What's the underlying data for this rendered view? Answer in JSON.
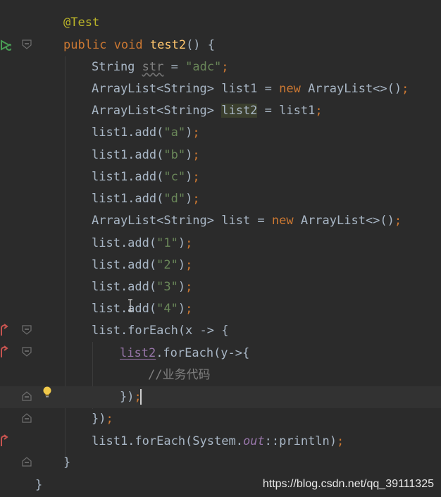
{
  "editor": {
    "language": "java",
    "theme_colors": {
      "background": "#2b2b2b",
      "current_line": "#323232",
      "keyword": "#cc7832",
      "annotation": "#bbb529",
      "string": "#6a8759",
      "method_declaration": "#ffc66d",
      "comment": "#808080",
      "static_field": "#9876aa",
      "default_text": "#a9b7c6"
    },
    "gutter_icons": [
      "run-test-icon",
      "fold-icon",
      "recursive-call-icon",
      "intention-bulb-icon"
    ],
    "current_line_number": 18,
    "code": {
      "l1_annotation": "@Test",
      "l2_public": "public",
      "l2_void": "void",
      "l2_name": "test2",
      "l2_rest": "() {",
      "l3_type": "String",
      "l3_var": "str",
      "l3_eq": " = ",
      "l3_value": "\"adc\"",
      "l3_semi": ";",
      "l4_decl": "ArrayList<String> list1 = ",
      "l4_new": "new",
      "l4_ctor": " ArrayList<>()",
      "l4_semi": ";",
      "l5_decl": "ArrayList<String> ",
      "l5_var": "list2",
      "l5_assign": " = list1",
      "l5_semi": ";",
      "l6_call": "list1.add(",
      "l6_arg": "\"a\"",
      "l6_end": ")",
      "l6_semi": ";",
      "l7_call": "list1.add(",
      "l7_arg": "\"b\"",
      "l7_end": ")",
      "l7_semi": ";",
      "l8_call": "list1.add(",
      "l8_arg": "\"c\"",
      "l8_end": ")",
      "l8_semi": ";",
      "l9_call": "list1.add(",
      "l9_arg": "\"d\"",
      "l9_end": ")",
      "l9_semi": ";",
      "l10_decl": "ArrayList<String> list = ",
      "l10_new": "new",
      "l10_ctor": " ArrayList<>()",
      "l10_semi": ";",
      "l11_call": "list.add(",
      "l11_arg": "\"1\"",
      "l11_end": ")",
      "l11_semi": ";",
      "l12_call": "list.add(",
      "l12_arg": "\"2\"",
      "l12_end": ")",
      "l12_semi": ";",
      "l13_call": "list.add(",
      "l13_arg": "\"3\"",
      "l13_end": ")",
      "l13_semi": ";",
      "l14_call": "list.add(",
      "l14_arg": "\"4\"",
      "l14_end": ")",
      "l14_semi": ";",
      "l15_text": "list.forEach(x -> {",
      "l16_var": "list2",
      "l16_rest": ".forEach(y->{",
      "l17_comment": "//业务代码",
      "l18_text": "})",
      "l18_semi": ";",
      "l19_text": "})",
      "l19_semi": ";",
      "l20_call": "list1.forEach(System.",
      "l20_field": "out",
      "l20_rest": "::println)",
      "l20_semi": ";",
      "l21_text": "}",
      "l22_text": "}"
    }
  },
  "watermark": "https://blog.csdn.net/qq_39111325"
}
